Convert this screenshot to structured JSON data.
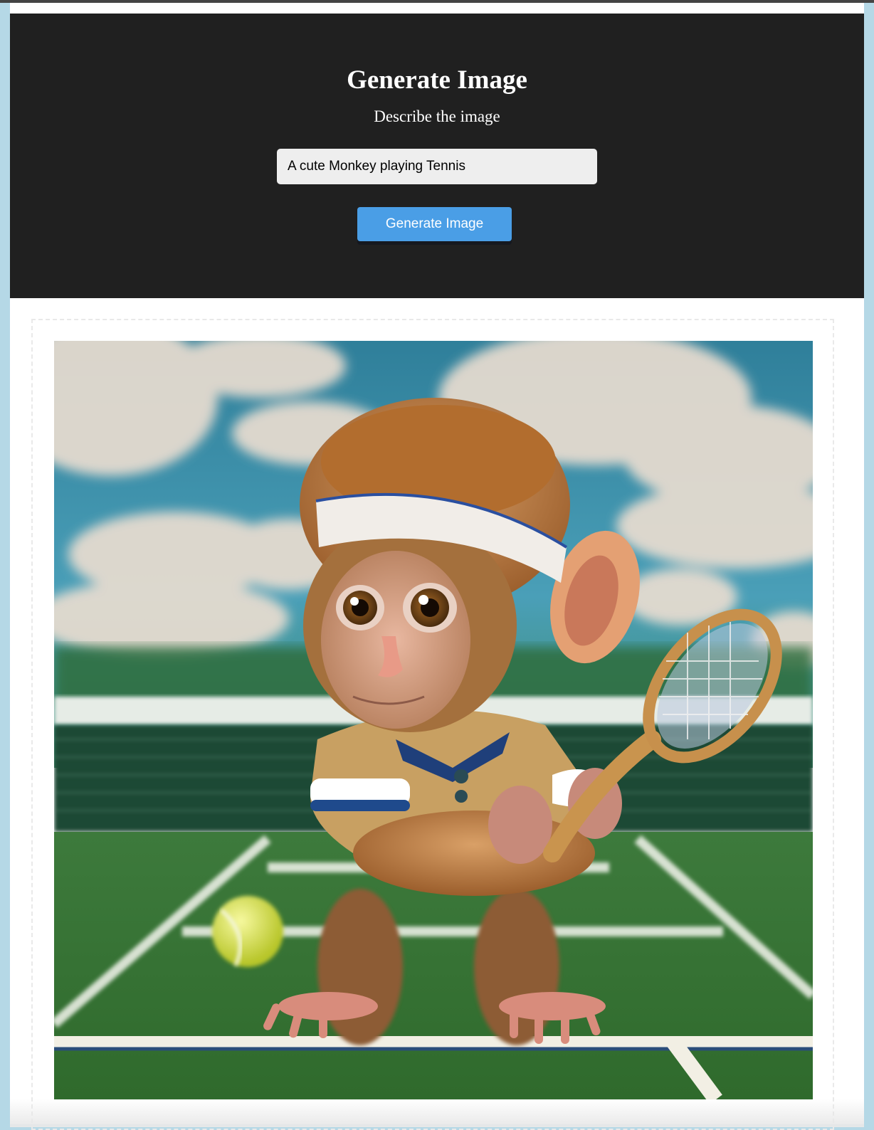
{
  "hero": {
    "title": "Generate Image",
    "subtitle": "Describe the image",
    "prompt_value": "A cute Monkey playing Tennis",
    "button_label": "Generate Image"
  },
  "colors": {
    "hero_bg": "#202020",
    "button": "#4a9ee6",
    "page_bg": "#b5d8e6"
  },
  "result": {
    "image_subject": "monkey-playing-tennis-image"
  }
}
